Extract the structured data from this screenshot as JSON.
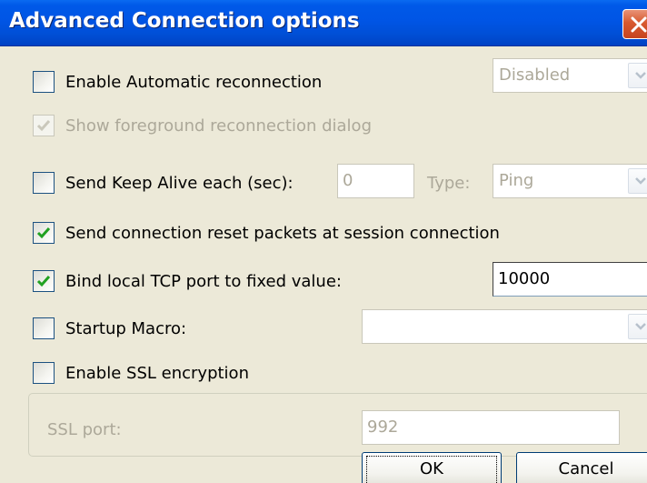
{
  "window": {
    "title": "Advanced Connection options"
  },
  "options": {
    "auto_reconnect": {
      "label": "Enable Automatic reconnection",
      "checked": false,
      "mode_value": "Disabled"
    },
    "show_fg_dialog": {
      "label": "Show foreground reconnection dialog",
      "checked": true,
      "enabled": false
    },
    "keep_alive": {
      "label": "Send Keep Alive each (sec):",
      "checked": false,
      "seconds": "0",
      "type_label": "Type:",
      "type_value": "Ping"
    },
    "reset_packets": {
      "label": "Send connection reset packets at session connection",
      "checked": true
    },
    "bind_port": {
      "label": "Bind local TCP port to fixed value:",
      "checked": true,
      "port": "10000"
    },
    "startup_macro": {
      "label": "Startup Macro:",
      "checked": false,
      "macro_value": ""
    },
    "ssl": {
      "label": "Enable SSL encryption",
      "checked": false,
      "port_label": "SSL port:",
      "port": "992"
    }
  },
  "buttons": {
    "ok": "OK",
    "cancel": "Cancel"
  },
  "colors": {
    "titlebar": "#0055e5",
    "dialog_bg": "#ece9d8",
    "check_mark": "#21a121",
    "disabled_text": "#aca899"
  },
  "icons": {
    "close": "close-icon",
    "check": "check-icon",
    "dropdown": "chevron-down-icon"
  }
}
